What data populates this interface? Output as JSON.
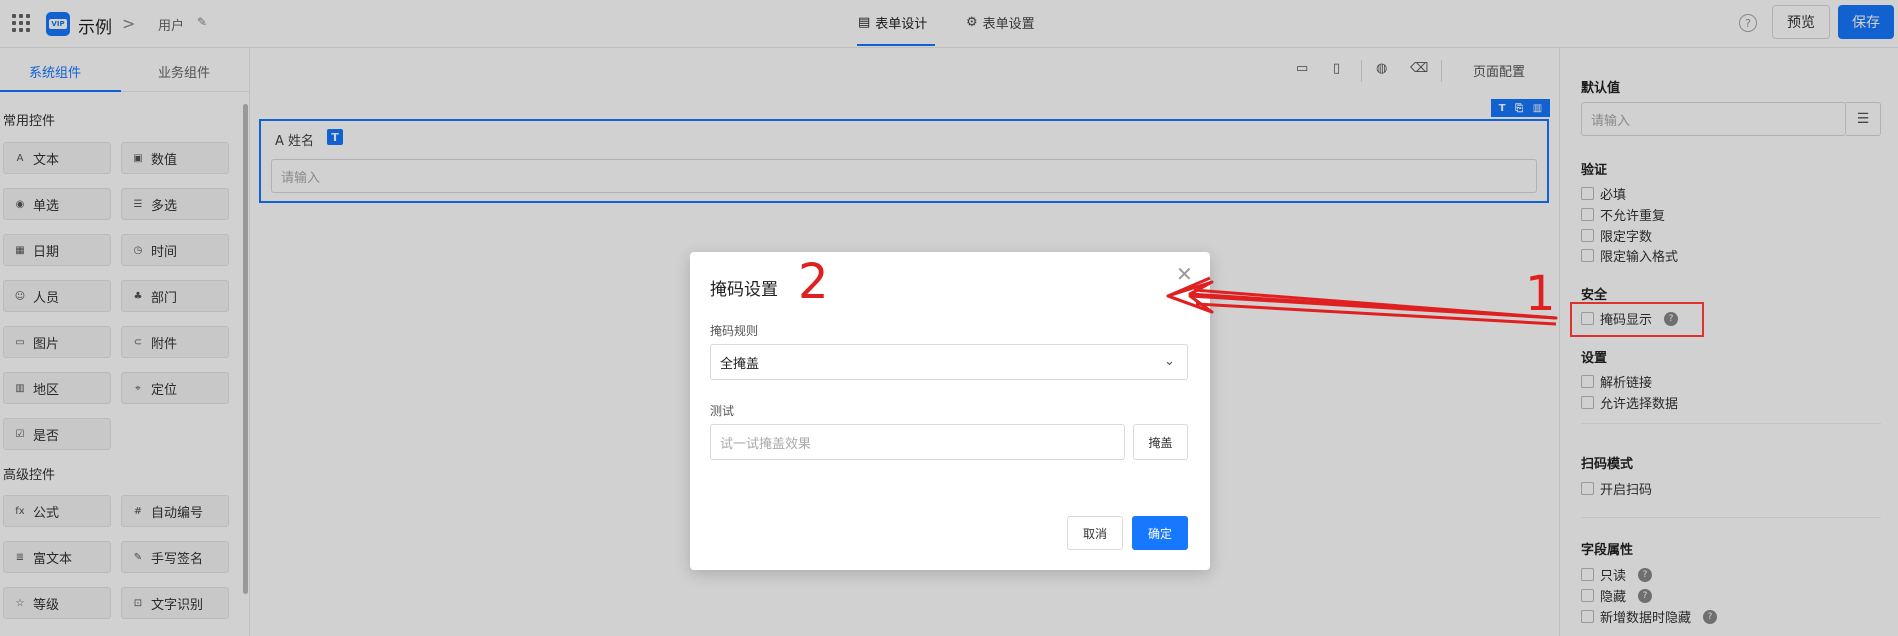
{
  "topbar": {
    "app_name": "示例",
    "breadcrumb_chevron": ">",
    "breadcrumb_user": "用户",
    "tabs": [
      {
        "label": "表单设计",
        "icon": "document-icon",
        "active": true
      },
      {
        "label": "表单设置",
        "icon": "gear-icon",
        "active": false
      }
    ],
    "preview_label": "预览",
    "save_label": "保存",
    "accent": "#1677ff"
  },
  "left_panel": {
    "tabs": [
      "系统组件",
      "业务组件"
    ],
    "section_common": "常用控件",
    "common": [
      {
        "label": "文本",
        "icon": "A"
      },
      {
        "label": "数值",
        "icon": "▣"
      },
      {
        "label": "单选",
        "icon": "◉"
      },
      {
        "label": "多选",
        "icon": "☰"
      },
      {
        "label": "日期",
        "icon": "▦"
      },
      {
        "label": "时间",
        "icon": "◷"
      },
      {
        "label": "人员",
        "icon": "☺"
      },
      {
        "label": "部门",
        "icon": "♣"
      },
      {
        "label": "图片",
        "icon": "▭"
      },
      {
        "label": "附件",
        "icon": "⊂"
      },
      {
        "label": "地区",
        "icon": "▥"
      },
      {
        "label": "定位",
        "icon": "⌖"
      },
      {
        "label": "是否",
        "icon": "☑"
      }
    ],
    "section_advanced": "高级控件",
    "advanced": [
      {
        "label": "公式",
        "icon": "fx"
      },
      {
        "label": "自动编号",
        "icon": "#"
      },
      {
        "label": "富文本",
        "icon": "≣"
      },
      {
        "label": "手写签名",
        "icon": "✎"
      },
      {
        "label": "等级",
        "icon": "☆"
      },
      {
        "label": "文字识别",
        "icon": "⊡"
      }
    ]
  },
  "canvas": {
    "toolbar_page_config": "页面配置",
    "field_label": "A 姓名",
    "field_badge": "T",
    "field_placeholder": "请输入"
  },
  "right_panel": {
    "default_value_title": "默认值",
    "default_value_placeholder": "请输入",
    "validation_title": "验证",
    "validation": [
      "必填",
      "不允许重复",
      "限定字数",
      "限定输入格式"
    ],
    "security_title": "安全",
    "mask_display": "掩码显示",
    "settings_title": "设置",
    "settings": [
      "解析链接",
      "允许选择数据"
    ],
    "scan_title": "扫码模式",
    "scan_option": "开启扫码",
    "field_attr_title": "字段属性",
    "field_attr": [
      "只读",
      "隐藏",
      "新增数据时隐藏"
    ]
  },
  "modal": {
    "title": "掩码设置",
    "rule_label": "掩码规则",
    "rule_value": "全掩盖",
    "test_label": "测试",
    "test_placeholder": "试一试掩盖效果",
    "mask_button": "掩盖",
    "cancel": "取消",
    "confirm": "确定"
  },
  "annotations": {
    "marker_1": "1",
    "marker_2": "2",
    "color": "#e02020"
  }
}
